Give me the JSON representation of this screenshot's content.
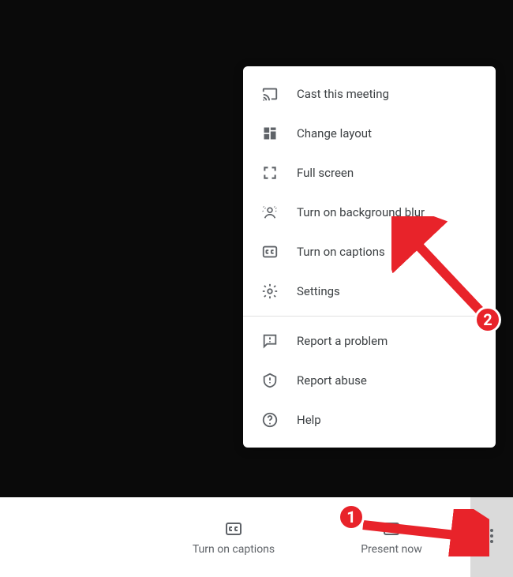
{
  "menu": {
    "section1": [
      {
        "icon": "cast",
        "label": "Cast this meeting"
      },
      {
        "icon": "layout",
        "label": "Change layout"
      },
      {
        "icon": "full",
        "label": "Full screen"
      },
      {
        "icon": "blur",
        "label": "Turn on background blur"
      },
      {
        "icon": "cc",
        "label": "Turn on captions"
      },
      {
        "icon": "gear",
        "label": "Settings"
      }
    ],
    "section2": [
      {
        "icon": "report",
        "label": "Report a problem"
      },
      {
        "icon": "abuse",
        "label": "Report abuse"
      },
      {
        "icon": "help",
        "label": "Help"
      }
    ]
  },
  "bottomBar": {
    "captions": {
      "label": "Turn on captions"
    },
    "present": {
      "label": "Present now"
    }
  },
  "annotations": {
    "step1": "1",
    "step2": "2"
  }
}
